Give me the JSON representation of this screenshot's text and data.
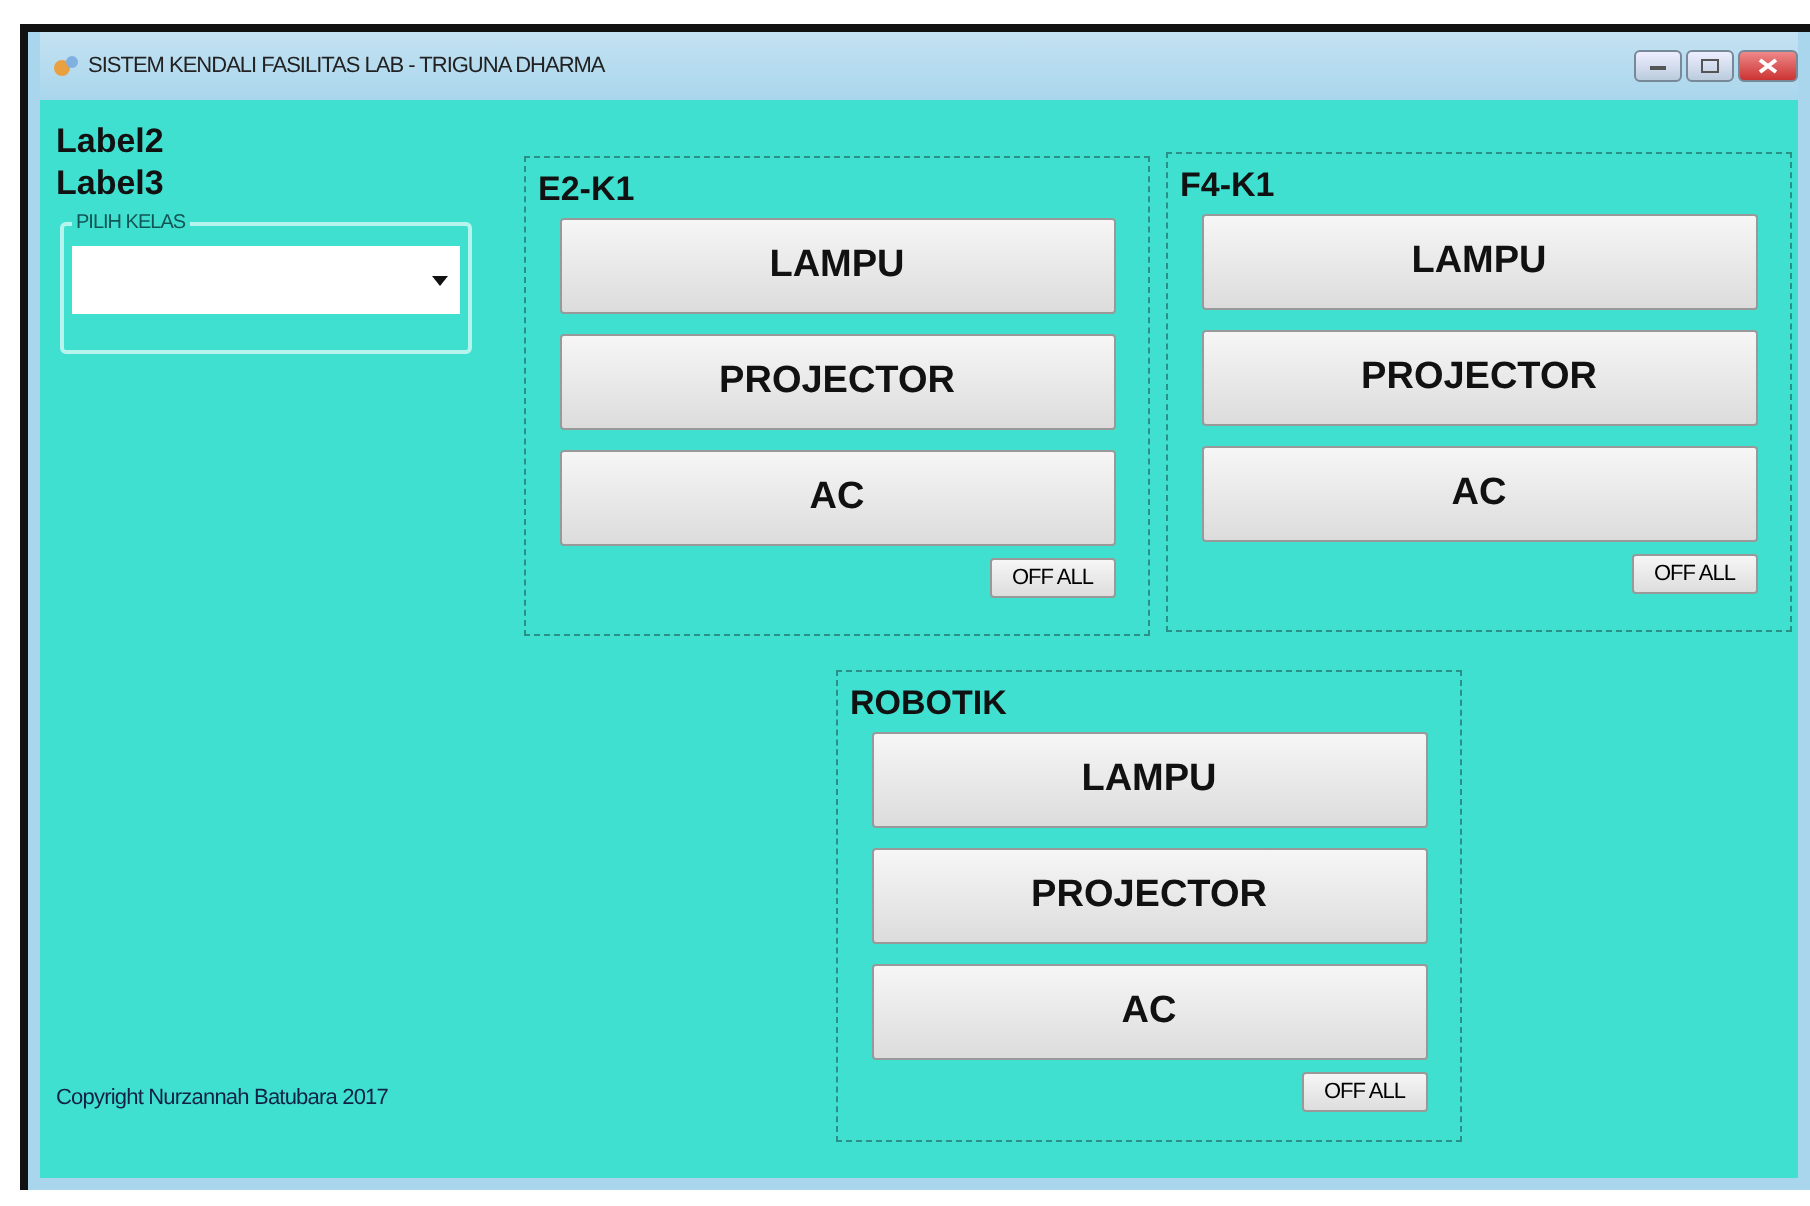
{
  "window": {
    "title": "SISTEM KENDALI FASILITAS LAB - TRIGUNA DHARMA"
  },
  "labels": [
    "Label2",
    "Label3"
  ],
  "class_picker": {
    "legend": "PILIH KELAS"
  },
  "panels": [
    {
      "title": "E2-K1",
      "buttons": [
        "LAMPU",
        "PROJECTOR",
        "AC"
      ],
      "off_button": "OFF ALL"
    },
    {
      "title": "F4-K1",
      "buttons": [
        "LAMPU",
        "PROJECTOR",
        "AC"
      ],
      "off_button": "OFF ALL"
    },
    {
      "title": "ROBOTIK",
      "buttons": [
        "LAMPU",
        "PROJECTOR",
        "AC"
      ],
      "off_button": "OFF ALL"
    }
  ],
  "copyright": "Copyright Nurzannah Batubara 2017"
}
